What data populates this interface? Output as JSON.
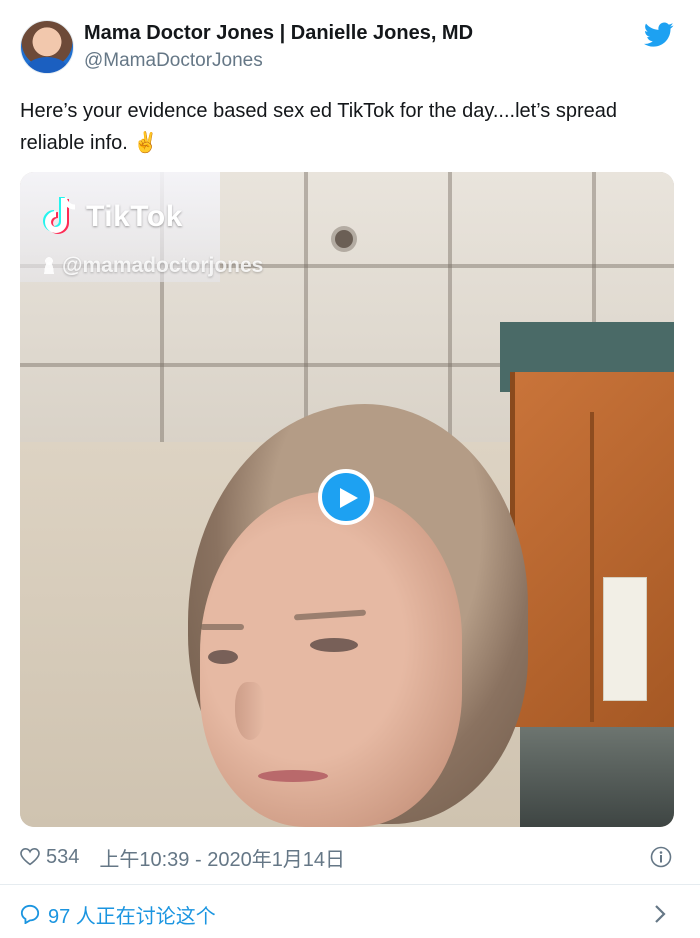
{
  "author": {
    "display_name": "Mama Doctor Jones | Danielle Jones, MD",
    "handle": "@MamaDoctorJones"
  },
  "tweet": {
    "text": "Here’s your evidence based sex ed TikTok for the day....let’s spread reliable info.",
    "emoji": "✌️"
  },
  "media": {
    "watermark_brand": "TikTok",
    "watermark_user": "@mamadoctorjones",
    "icons": [
      "tiktok-logo-icon",
      "user-icon",
      "play-icon"
    ]
  },
  "footer": {
    "likes": "534",
    "timestamp": "上午10:39 - 2020年1月14日",
    "discussion": "97 人正在讨论这个",
    "icons": [
      "heart-icon",
      "info-icon",
      "chat-bubble-icon",
      "chevron-right-icon"
    ]
  },
  "colors": {
    "accent": "#1da1f2",
    "link": "#1b95e0",
    "muted": "#657786"
  }
}
